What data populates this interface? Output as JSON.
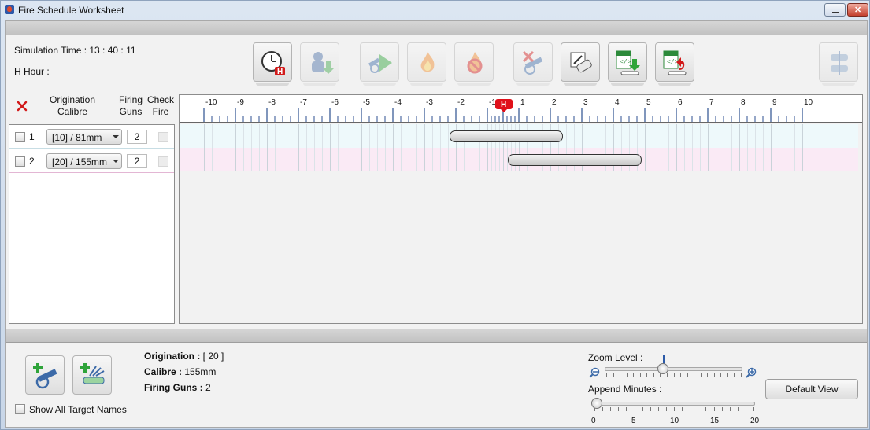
{
  "window": {
    "title": "Fire Schedule Worksheet",
    "minimize_icon": "minimize-icon",
    "close_icon": "close-icon"
  },
  "status": {
    "simulation_time_label": "Simulation Time : 13 : 40 : 11",
    "h_hour_label": "H Hour :"
  },
  "toolbar": {
    "buttons": [
      {
        "name": "set-h-hour",
        "icon": "clock-h-icon",
        "enabled": true
      },
      {
        "name": "import-unit",
        "icon": "soldier-download-icon",
        "enabled": false
      },
      {
        "name": "play",
        "icon": "gun-play-icon",
        "enabled": false
      },
      {
        "name": "fire",
        "icon": "flame-icon",
        "enabled": false
      },
      {
        "name": "cancel-fire",
        "icon": "flame-cancel-icon",
        "enabled": false
      },
      {
        "name": "delete-gun",
        "icon": "gun-delete-icon",
        "enabled": false
      },
      {
        "name": "edit",
        "icon": "pencil-eraser-icon",
        "enabled": true
      },
      {
        "name": "export-xml",
        "icon": "xml-export-icon",
        "enabled": true
      },
      {
        "name": "import-xml",
        "icon": "xml-import-icon",
        "enabled": true
      },
      {
        "name": "layout",
        "icon": "layout-toggle-icon",
        "enabled": false
      }
    ]
  },
  "table": {
    "clear_icon": "red-x-icon",
    "headers": {
      "origination": "Origination",
      "calibre": "Calibre",
      "firing": "Firing",
      "guns": "Guns",
      "check": "Check",
      "fire": "Fire"
    },
    "rows": [
      {
        "num": "1",
        "calibre": "[10] / 81mm",
        "guns": "2"
      },
      {
        "num": "2",
        "calibre": "[20] / 155mm",
        "guns": "2"
      }
    ]
  },
  "ruler": {
    "labels": [
      "-10",
      "-9",
      "-8",
      "-7",
      "-6",
      "-5",
      "-4",
      "-3",
      "-2",
      "-1",
      "1",
      "2",
      "3",
      "4",
      "5",
      "6",
      "7",
      "8",
      "9",
      "10"
    ],
    "h_marker": "H",
    "marker_color": "#e0101a"
  },
  "schedule": {
    "bars": [
      {
        "row": 1,
        "start_min": -2.2,
        "end_min": 2.4
      },
      {
        "row": 2,
        "start_min": 0.3,
        "end_min": 4.9
      }
    ],
    "lane_colors": [
      "#eef9fb",
      "#faeaf5"
    ]
  },
  "bottom": {
    "add_gun_icon": "add-gun-icon",
    "add_target_icon": "add-target-icon",
    "show_all_label": "Show All Target Names",
    "origination_label": "Origination :",
    "origination_value": " [ 20 ]",
    "calibre_label": "Calibre :",
    "calibre_value": " 155mm",
    "firing_guns_label": "Firing Guns :",
    "firing_guns_value": " 2",
    "zoom_label": "Zoom Level :",
    "zoom_fraction": 0.42,
    "append_label": "Append Minutes :",
    "append_value": 0,
    "append_ticks": [
      "0",
      "5",
      "10",
      "15",
      "20"
    ],
    "default_view_label": "Default View"
  }
}
